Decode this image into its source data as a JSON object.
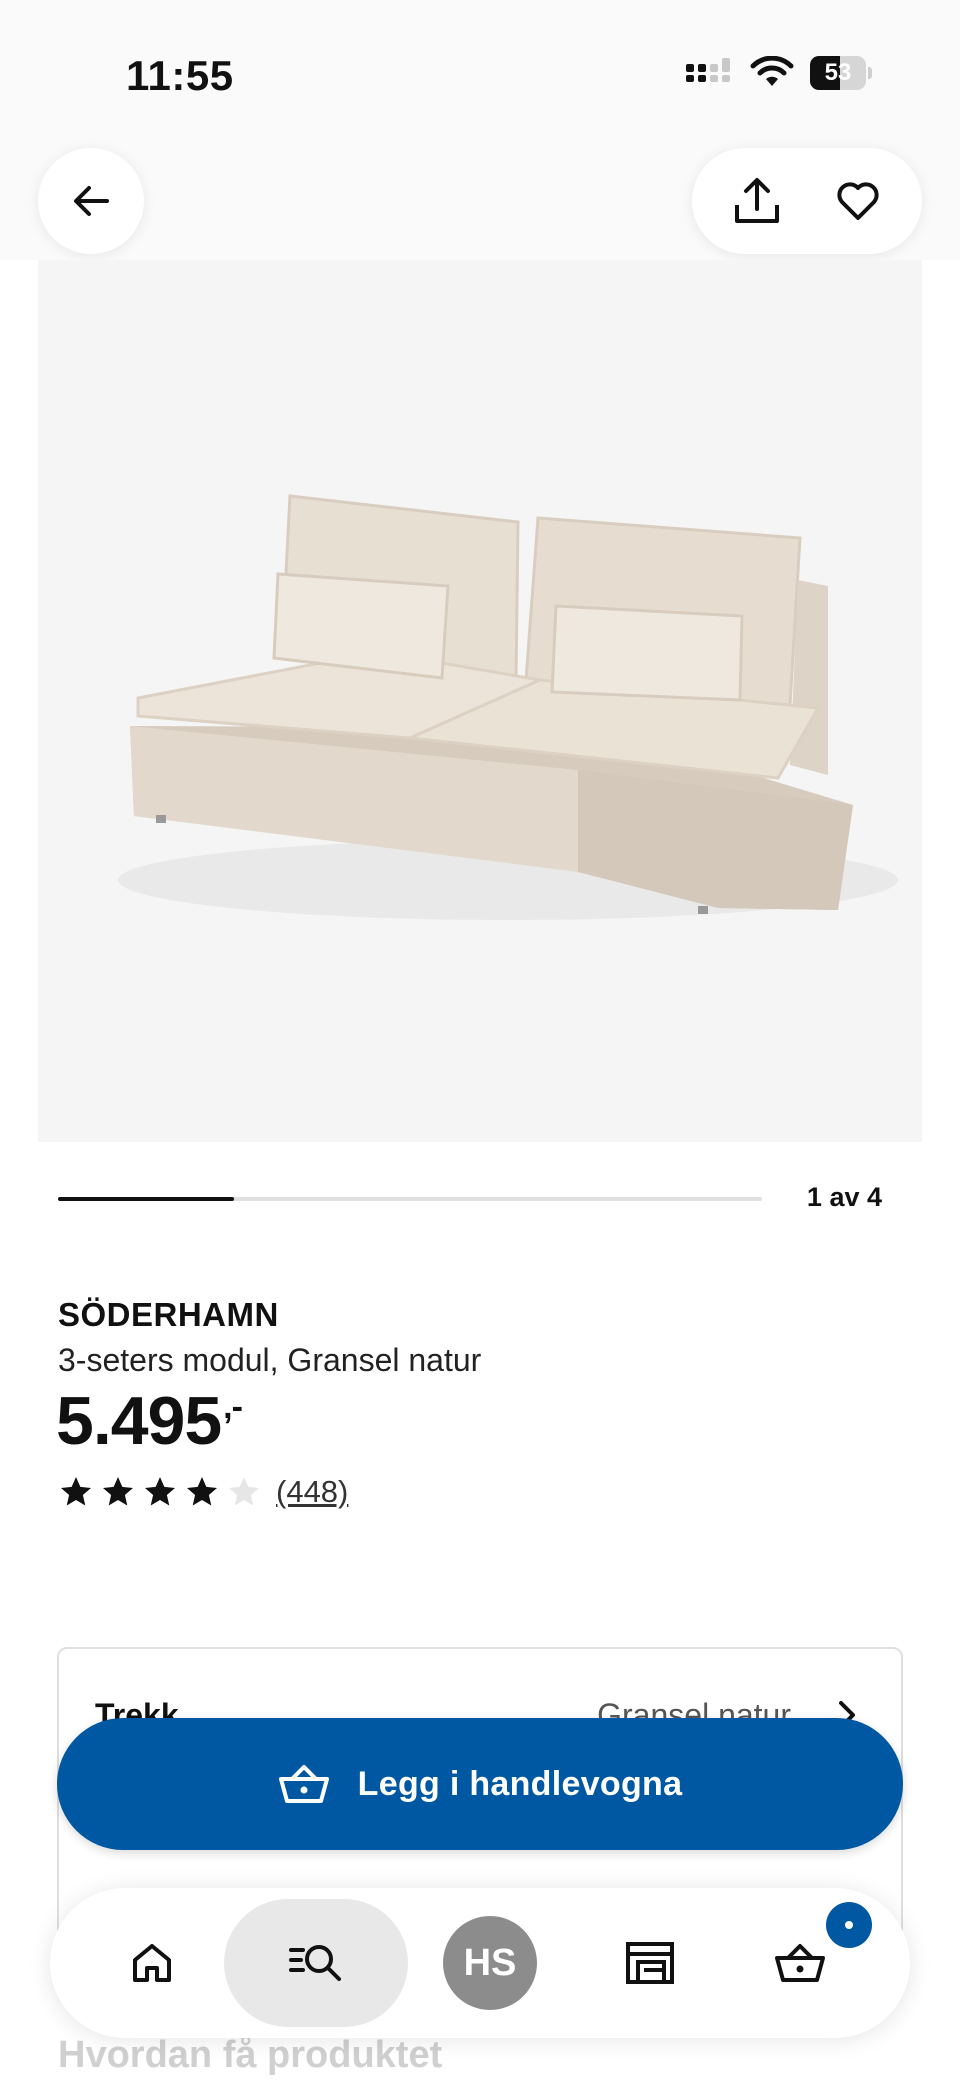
{
  "status_bar": {
    "time": "11:55",
    "battery_percent": "53",
    "battery_level": 0.53,
    "icons": [
      "cellular-signal-icon",
      "wifi-icon",
      "battery-icon"
    ]
  },
  "header": {
    "icons": [
      "arrow-left-icon",
      "share-icon",
      "heart-icon"
    ]
  },
  "product": {
    "name": "SÖDERHAMN",
    "description": "3-seters modul, Gransel natur",
    "price_main": "5.495",
    "price_suffix": ",-",
    "rating_value": 4,
    "rating_max": 5,
    "review_count": "(448)"
  },
  "gallery": {
    "indicator": "1 av 4",
    "current": 1,
    "total": 4
  },
  "option": {
    "label": "Trekk",
    "value": "Gransel natur"
  },
  "cart_button": {
    "label": "Legg i handlevogna"
  },
  "next_section": {
    "heading": "Hvordan få produktet"
  },
  "bottom_nav": {
    "avatar_initials": "HS",
    "items": [
      "home-icon",
      "search-icon",
      "avatar",
      "store-icon",
      "cart-icon"
    ],
    "cart_badge": true
  },
  "colors": {
    "accent": "#0058a3",
    "background": "#ffffff",
    "image_bg": "#f5f5f5",
    "sofa": "#e6dcd0",
    "avatar_bg": "#8c8c8c"
  }
}
